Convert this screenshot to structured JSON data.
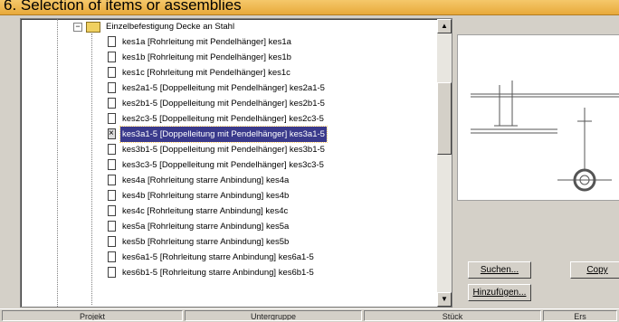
{
  "header": {
    "title": "6. Selection of items or assemblies"
  },
  "tree": {
    "folder_label": "Einzelbefestigung Decke an Stahl",
    "items": [
      {
        "label": "kes1a [Rohrleitung mit Pendelhänger] kes1a",
        "selected": false
      },
      {
        "label": "kes1b [Rohrleitung mit Pendelhänger] kes1b",
        "selected": false
      },
      {
        "label": "kes1c [Rohrleitung mit Pendelhänger] kes1c",
        "selected": false
      },
      {
        "label": "kes2a1-5 [Doppelleitung mit Pendelhänger] kes2a1-5",
        "selected": false
      },
      {
        "label": "kes2b1-5 [Doppelleitung mit Pendelhänger] kes2b1-5",
        "selected": false
      },
      {
        "label": "kes2c3-5 [Doppelleitung mit Pendelhänger] kes2c3-5",
        "selected": false
      },
      {
        "label": "kes3a1-5 [Doppelleitung mit Pendelhänger] kes3a1-5",
        "selected": true
      },
      {
        "label": "kes3b1-5 [Doppelleitung mit Pendelhänger] kes3b1-5",
        "selected": false
      },
      {
        "label": "kes3c3-5 [Doppelleitung mit Pendelhänger] kes3c3-5",
        "selected": false
      },
      {
        "label": "kes4a [Rohrleitung starre Anbindung] kes4a",
        "selected": false
      },
      {
        "label": "kes4b [Rohrleitung starre Anbindung] kes4b",
        "selected": false
      },
      {
        "label": "kes4c [Rohrleitung starre Anbindung] kes4c",
        "selected": false
      },
      {
        "label": "kes5a [Rohrleitung starre Anbindung] kes5a",
        "selected": false
      },
      {
        "label": "kes5b [Rohrleitung starre Anbindung] kes5b",
        "selected": false
      },
      {
        "label": "kes6a1-5 [Rohrleitung starre Anbindung] kes6a1-5",
        "selected": false
      },
      {
        "label": "kes6b1-5 [Rohrleitung starre Anbindung] kes6b1-5",
        "selected": false
      }
    ]
  },
  "buttons": {
    "search": "Suchen...",
    "add": "Hinzufügen...",
    "copy": "Copy"
  },
  "statusbar": {
    "panes": [
      "Projekt",
      "Untergruppe",
      "Stück",
      "Ers"
    ]
  },
  "colors": {
    "selection": "#3a3a8c",
    "title_bg": "#e8a93a"
  },
  "icons": [
    "folder-icon",
    "document-icon",
    "collapse-icon",
    "scroll-up-icon",
    "scroll-down-icon"
  ]
}
